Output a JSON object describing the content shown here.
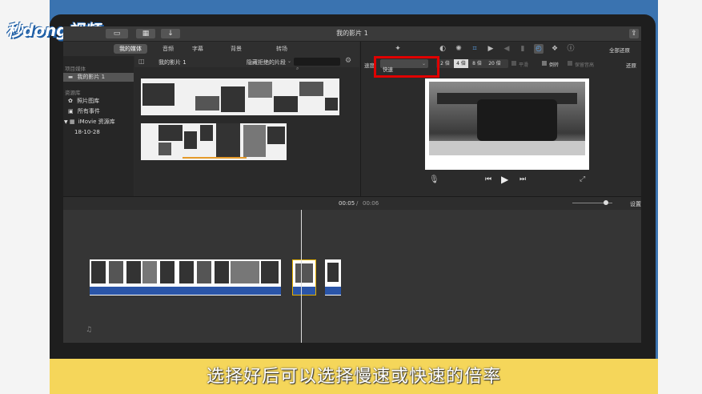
{
  "logo": {
    "text": "秒dong视频"
  },
  "window": {
    "title": "我的影片 1"
  },
  "tabs": [
    {
      "label": "我的媒体"
    },
    {
      "label": "音频"
    },
    {
      "label": "字幕"
    },
    {
      "label": "背景"
    },
    {
      "label": "转场"
    }
  ],
  "sidebar": {
    "project_header": "项目媒体",
    "project_item": "我的影片 1",
    "library_header": "资源库",
    "items": [
      {
        "label": "照片图库"
      },
      {
        "label": "所有事件"
      },
      {
        "label": "iMovie 资源库"
      },
      {
        "label": "18-10-28"
      }
    ]
  },
  "browser": {
    "title": "我的影片 1",
    "filter": "隐藏拒绝的片段",
    "search_placeholder": ""
  },
  "viewer": {
    "reset_all": "全部还原",
    "speed_label": "速度:",
    "speed_value": "快速",
    "speed_options": [
      "2 倍",
      "4 倍",
      "8 倍",
      "20 倍"
    ],
    "smooth": "平滑",
    "reverse": "倒转",
    "preserve_pitch": "保留音高",
    "reset": "还原"
  },
  "timebar": {
    "current": "00:05",
    "separator": "/",
    "total": "00:06",
    "settings": "设置"
  },
  "caption": {
    "text": "选择好后可以选择慢速或快速的倍率"
  },
  "colors": {
    "highlight": "#e00000",
    "clip_bar": "#2a55a8",
    "caption_bg": "#f5d65a"
  }
}
